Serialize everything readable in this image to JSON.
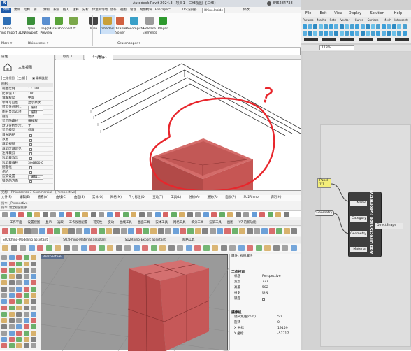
{
  "revit": {
    "title": "Autodesk Revit 2024.3 - 项目1 - 三维视图: {三维}",
    "user": "846284738",
    "file_btn": "文件",
    "tabs": [
      "建筑",
      "结构",
      "钢",
      "预制",
      "系统",
      "插入",
      "注释",
      "分析",
      "体量和场地",
      "协作",
      "视图",
      "管理",
      "附加模块",
      "Enscape™",
      "D5 渲染器",
      "Rhino.Inside",
      "修改"
    ],
    "active_tab": "Rhino.Inside",
    "ribbon": [
      {
        "label": "Rhino",
        "sub": "Rhino Import 3DM"
      },
      {
        "label": "Open",
        "sub": "Viewport"
      },
      {
        "label": "Toggle",
        "sub": "Preview"
      },
      {
        "label": "Grasshopper",
        "sub": ""
      },
      {
        "label": "Off",
        "sub": ""
      },
      {
        "label": "Wire",
        "sub": ""
      },
      {
        "label": "Shaded",
        "sub": ""
      },
      {
        "label": "Disable",
        "sub": "Solver"
      },
      {
        "label": "Recompute",
        "sub": ""
      },
      {
        "label": "Release",
        "sub": "Elements"
      },
      {
        "label": "Player",
        "sub": ""
      }
    ],
    "panel_labels": {
      "more": "More",
      "rhinoceros": "Rhinoceros",
      "grasshopper": "Grasshopper"
    },
    "view_tabs": [
      "标高 1",
      "{三维}"
    ],
    "viewport_label": "{三维}",
    "props": {
      "title": "属性",
      "type": "三维视图",
      "selector": "三维视图: {三维}",
      "edit_type": "编辑类型",
      "section": "图形",
      "rows": [
        [
          "视图比例",
          "1 : 100"
        ],
        [
          "比例值 1:",
          "100"
        ],
        [
          "详细程度",
          "中等"
        ],
        [
          "零件可见性",
          "显示原状"
        ],
        [
          "可见性/图形...",
          "编辑..."
        ],
        [
          "图形显示选项",
          "编辑..."
        ],
        [
          "规程",
          "协调"
        ],
        [
          "显示隐藏线",
          "按规程"
        ],
        [
          "默认分析显示...",
          "无"
        ],
        [
          "显示模型",
          "标准"
        ],
        [
          "日光路径",
          ""
        ],
        [
          "范围",
          ""
        ],
        [
          "裁剪视图",
          ""
        ],
        [
          "裁剪区域可见",
          ""
        ],
        [
          "注释裁剪",
          ""
        ],
        [
          "远剪裁激活",
          ""
        ],
        [
          "远剪裁偏移",
          "304800.0"
        ],
        [
          "剖面框",
          ""
        ],
        [
          "相机",
          ""
        ],
        [
          "渲染设置",
          "编辑..."
        ],
        [
          "锁定的方向",
          ""
        ]
      ]
    }
  },
  "rhino": {
    "title": "无标 - Rhinoceros 7 Commercial - [Perspective]",
    "cmd1": "指令: _Perspective",
    "cmd2": "指令: 锁定视窗推移",
    "menu": [
      "文件(F)",
      "编辑(E)",
      "查看(V)",
      "曲线(C)",
      "曲面(S)",
      "实体(O)",
      "网格(M)",
      "尺寸标注(D)",
      "变动(T)",
      "工具(L)",
      "分析(A)",
      "渲染(R)",
      "面板(P)",
      "SU2Rhino",
      "说明(H)"
    ],
    "toolbar_tabs": [
      "工作平面",
      "设置视图",
      "显示",
      "选取",
      "工作视窗配置",
      "可见性",
      "变动",
      "曲线工具",
      "曲面工具",
      "实体工具",
      "网格工具",
      "细分工具",
      "渲染工具",
      "出图",
      "V7 的新功能"
    ],
    "plugin_tabs": [
      "SU2Rhino-Modeling assistant",
      "SU2Rhino-Material assistant",
      "SU2Rhino-Export assistant",
      "网格工具"
    ],
    "viewport_label": "Perspective",
    "props": {
      "header": "属性: 视图属性",
      "section1": "工作视窗",
      "rows1": [
        [
          "标题",
          "Perspective"
        ],
        [
          "宽度",
          "737"
        ],
        [
          "高度",
          "502"
        ],
        [
          "投影",
          "透视"
        ],
        [
          "锁定",
          ""
        ]
      ],
      "section2": "摄像机",
      "rows2": [
        [
          "镜头焦距(mm)",
          "50"
        ],
        [
          "旋转",
          "0"
        ],
        [
          "X 坐标",
          "19159"
        ],
        [
          "Y 坐标",
          "-52717"
        ]
      ]
    }
  },
  "grasshopper": {
    "menu": [
      "File",
      "Edit",
      "View",
      "Display",
      "Solution",
      "Help"
    ],
    "tabs": [
      "Params",
      "Maths",
      "Sets",
      "Vector",
      "Curve",
      "Surface",
      "Mesh",
      "Intersect"
    ],
    "zoom": "118%",
    "panel_label": "Panel",
    "panel_value": "1\\1",
    "geometry_label": "Geometry",
    "component": {
      "title": "Add DirectShape (Geometry)",
      "inputs": [
        "Name",
        "Category",
        "Geometry",
        "Material"
      ],
      "output": "DirectShape"
    }
  },
  "annotation": {
    "mark": "?",
    "color": "#e8262c"
  },
  "colors": {
    "box": "#c85a58",
    "box_dark": "#a84444",
    "box_top": "#d46c6a",
    "revit_blue": "#1e5aa8",
    "accent": "#3b78c8"
  }
}
